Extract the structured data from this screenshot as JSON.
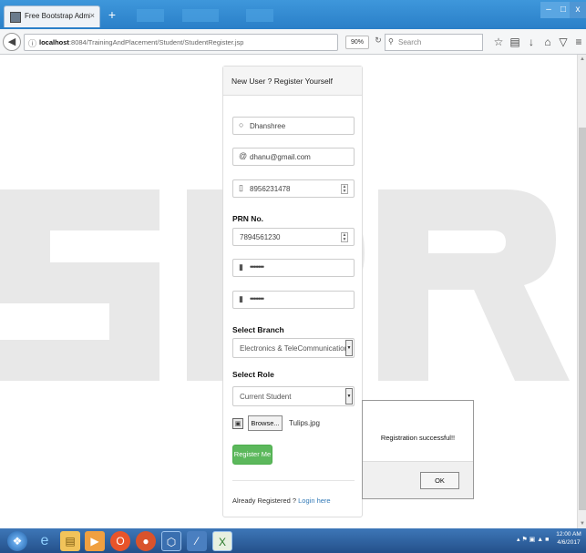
{
  "browser": {
    "tab_title": "Free Bootstrap Admin Templ",
    "tab_close": "×",
    "new_tab": "+",
    "url_host": "localhost",
    "url_path": ":8084/TrainingAndPlacement/Student/StudentRegister.jsp",
    "zoom": "90%",
    "search_placeholder": "Search"
  },
  "window_controls": {
    "minimize": "–",
    "maximize": "□",
    "close": "x"
  },
  "panel": {
    "heading": "New User ? Register Yourself",
    "name_value": "Dhanshree",
    "email_value": "dhanu@gmail.com",
    "phone_value": "8956231478",
    "prn_label": "PRN No.",
    "prn_value": "7894561230",
    "password_value": "•••••••",
    "confirm_password_value": "•••••••",
    "branch_label": "Select Branch",
    "branch_value": "Electronics & TeleCommunication",
    "role_label": "Select Role",
    "role_value": "Current Student",
    "browse_label": "Browse...",
    "file_name": "Tulips.jpg",
    "register_label": "Register Me",
    "already_text": "Already Registered ?",
    "login_link": "Login here"
  },
  "dialog": {
    "message": "Registration successful!!",
    "ok_label": "OK"
  },
  "taskbar": {
    "time": "12:00 AM",
    "date": "4/6/2017"
  },
  "colors": {
    "register_button": "#5cb85c",
    "login_link": "#337ab7",
    "title_bar": "#2a7fc8",
    "taskbar": "#24508a"
  }
}
